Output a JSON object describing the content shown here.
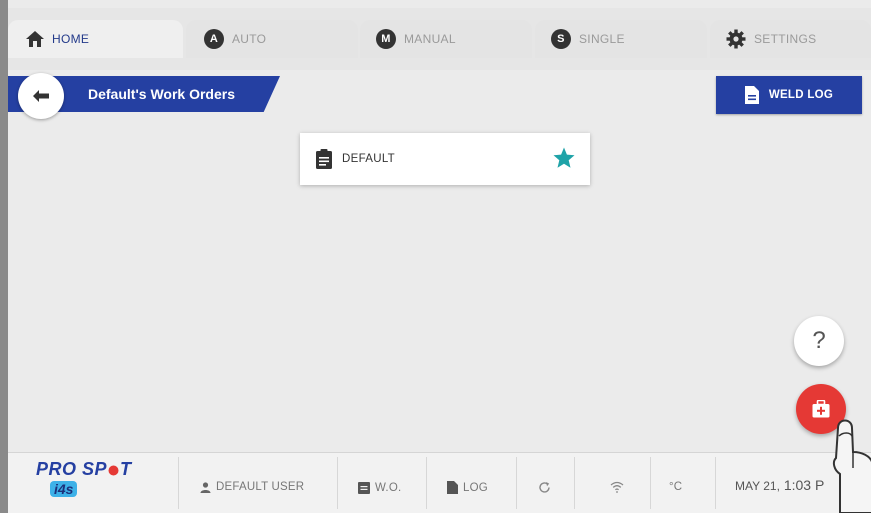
{
  "tabs": [
    {
      "label": "HOME",
      "icon": "home-icon",
      "badge": ""
    },
    {
      "label": "AUTO",
      "icon": "auto-badge-icon",
      "badge": "A"
    },
    {
      "label": "MANUAL",
      "icon": "manual-badge-icon",
      "badge": "M"
    },
    {
      "label": "SINGLE",
      "icon": "single-badge-icon",
      "badge": "S"
    },
    {
      "label": "SETTINGS",
      "icon": "gear-icon",
      "badge": ""
    }
  ],
  "header": {
    "title": "Default's Work Orders",
    "weld_log_label": "WELD LOG"
  },
  "work_orders": [
    {
      "name": "DEFAULT",
      "favorite": true
    }
  ],
  "floating": {
    "help_label": "?"
  },
  "status_bar": {
    "brand_line1": "PRO SP",
    "brand_line1_tail": "T",
    "brand_line2": "i4s",
    "user": "DEFAULT USER",
    "work_order": "W.O.",
    "log": "LOG",
    "temperature_unit": "°C",
    "date": "MAY 21,",
    "time": "1:03 P"
  },
  "colors": {
    "primary": "#2540a2",
    "accent_star": "#1fa3a8",
    "fab_red": "#e53935",
    "background": "#ebebeb"
  }
}
